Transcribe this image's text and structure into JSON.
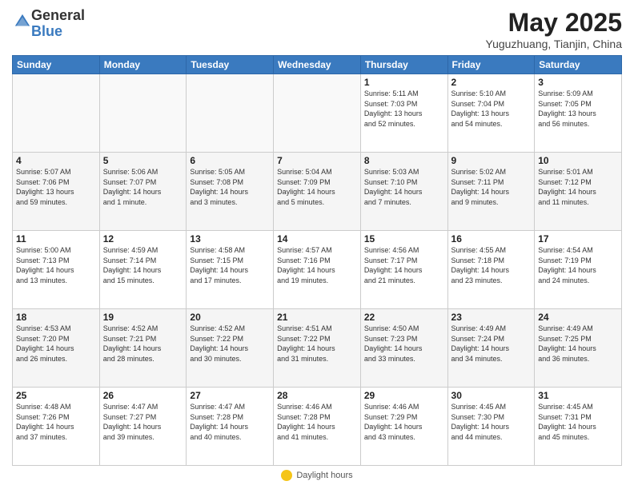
{
  "header": {
    "logo_general": "General",
    "logo_blue": "Blue",
    "main_title": "May 2025",
    "subtitle": "Yuguzhuang, Tianjin, China"
  },
  "days_of_week": [
    "Sunday",
    "Monday",
    "Tuesday",
    "Wednesday",
    "Thursday",
    "Friday",
    "Saturday"
  ],
  "weeks": [
    [
      {
        "num": "",
        "info": ""
      },
      {
        "num": "",
        "info": ""
      },
      {
        "num": "",
        "info": ""
      },
      {
        "num": "",
        "info": ""
      },
      {
        "num": "1",
        "info": "Sunrise: 5:11 AM\nSunset: 7:03 PM\nDaylight: 13 hours\nand 52 minutes."
      },
      {
        "num": "2",
        "info": "Sunrise: 5:10 AM\nSunset: 7:04 PM\nDaylight: 13 hours\nand 54 minutes."
      },
      {
        "num": "3",
        "info": "Sunrise: 5:09 AM\nSunset: 7:05 PM\nDaylight: 13 hours\nand 56 minutes."
      }
    ],
    [
      {
        "num": "4",
        "info": "Sunrise: 5:07 AM\nSunset: 7:06 PM\nDaylight: 13 hours\nand 59 minutes."
      },
      {
        "num": "5",
        "info": "Sunrise: 5:06 AM\nSunset: 7:07 PM\nDaylight: 14 hours\nand 1 minute."
      },
      {
        "num": "6",
        "info": "Sunrise: 5:05 AM\nSunset: 7:08 PM\nDaylight: 14 hours\nand 3 minutes."
      },
      {
        "num": "7",
        "info": "Sunrise: 5:04 AM\nSunset: 7:09 PM\nDaylight: 14 hours\nand 5 minutes."
      },
      {
        "num": "8",
        "info": "Sunrise: 5:03 AM\nSunset: 7:10 PM\nDaylight: 14 hours\nand 7 minutes."
      },
      {
        "num": "9",
        "info": "Sunrise: 5:02 AM\nSunset: 7:11 PM\nDaylight: 14 hours\nand 9 minutes."
      },
      {
        "num": "10",
        "info": "Sunrise: 5:01 AM\nSunset: 7:12 PM\nDaylight: 14 hours\nand 11 minutes."
      }
    ],
    [
      {
        "num": "11",
        "info": "Sunrise: 5:00 AM\nSunset: 7:13 PM\nDaylight: 14 hours\nand 13 minutes."
      },
      {
        "num": "12",
        "info": "Sunrise: 4:59 AM\nSunset: 7:14 PM\nDaylight: 14 hours\nand 15 minutes."
      },
      {
        "num": "13",
        "info": "Sunrise: 4:58 AM\nSunset: 7:15 PM\nDaylight: 14 hours\nand 17 minutes."
      },
      {
        "num": "14",
        "info": "Sunrise: 4:57 AM\nSunset: 7:16 PM\nDaylight: 14 hours\nand 19 minutes."
      },
      {
        "num": "15",
        "info": "Sunrise: 4:56 AM\nSunset: 7:17 PM\nDaylight: 14 hours\nand 21 minutes."
      },
      {
        "num": "16",
        "info": "Sunrise: 4:55 AM\nSunset: 7:18 PM\nDaylight: 14 hours\nand 23 minutes."
      },
      {
        "num": "17",
        "info": "Sunrise: 4:54 AM\nSunset: 7:19 PM\nDaylight: 14 hours\nand 24 minutes."
      }
    ],
    [
      {
        "num": "18",
        "info": "Sunrise: 4:53 AM\nSunset: 7:20 PM\nDaylight: 14 hours\nand 26 minutes."
      },
      {
        "num": "19",
        "info": "Sunrise: 4:52 AM\nSunset: 7:21 PM\nDaylight: 14 hours\nand 28 minutes."
      },
      {
        "num": "20",
        "info": "Sunrise: 4:52 AM\nSunset: 7:22 PM\nDaylight: 14 hours\nand 30 minutes."
      },
      {
        "num": "21",
        "info": "Sunrise: 4:51 AM\nSunset: 7:22 PM\nDaylight: 14 hours\nand 31 minutes."
      },
      {
        "num": "22",
        "info": "Sunrise: 4:50 AM\nSunset: 7:23 PM\nDaylight: 14 hours\nand 33 minutes."
      },
      {
        "num": "23",
        "info": "Sunrise: 4:49 AM\nSunset: 7:24 PM\nDaylight: 14 hours\nand 34 minutes."
      },
      {
        "num": "24",
        "info": "Sunrise: 4:49 AM\nSunset: 7:25 PM\nDaylight: 14 hours\nand 36 minutes."
      }
    ],
    [
      {
        "num": "25",
        "info": "Sunrise: 4:48 AM\nSunset: 7:26 PM\nDaylight: 14 hours\nand 37 minutes."
      },
      {
        "num": "26",
        "info": "Sunrise: 4:47 AM\nSunset: 7:27 PM\nDaylight: 14 hours\nand 39 minutes."
      },
      {
        "num": "27",
        "info": "Sunrise: 4:47 AM\nSunset: 7:28 PM\nDaylight: 14 hours\nand 40 minutes."
      },
      {
        "num": "28",
        "info": "Sunrise: 4:46 AM\nSunset: 7:28 PM\nDaylight: 14 hours\nand 41 minutes."
      },
      {
        "num": "29",
        "info": "Sunrise: 4:46 AM\nSunset: 7:29 PM\nDaylight: 14 hours\nand 43 minutes."
      },
      {
        "num": "30",
        "info": "Sunrise: 4:45 AM\nSunset: 7:30 PM\nDaylight: 14 hours\nand 44 minutes."
      },
      {
        "num": "31",
        "info": "Sunrise: 4:45 AM\nSunset: 7:31 PM\nDaylight: 14 hours\nand 45 minutes."
      }
    ]
  ],
  "footer": {
    "daylight_label": "Daylight hours"
  }
}
